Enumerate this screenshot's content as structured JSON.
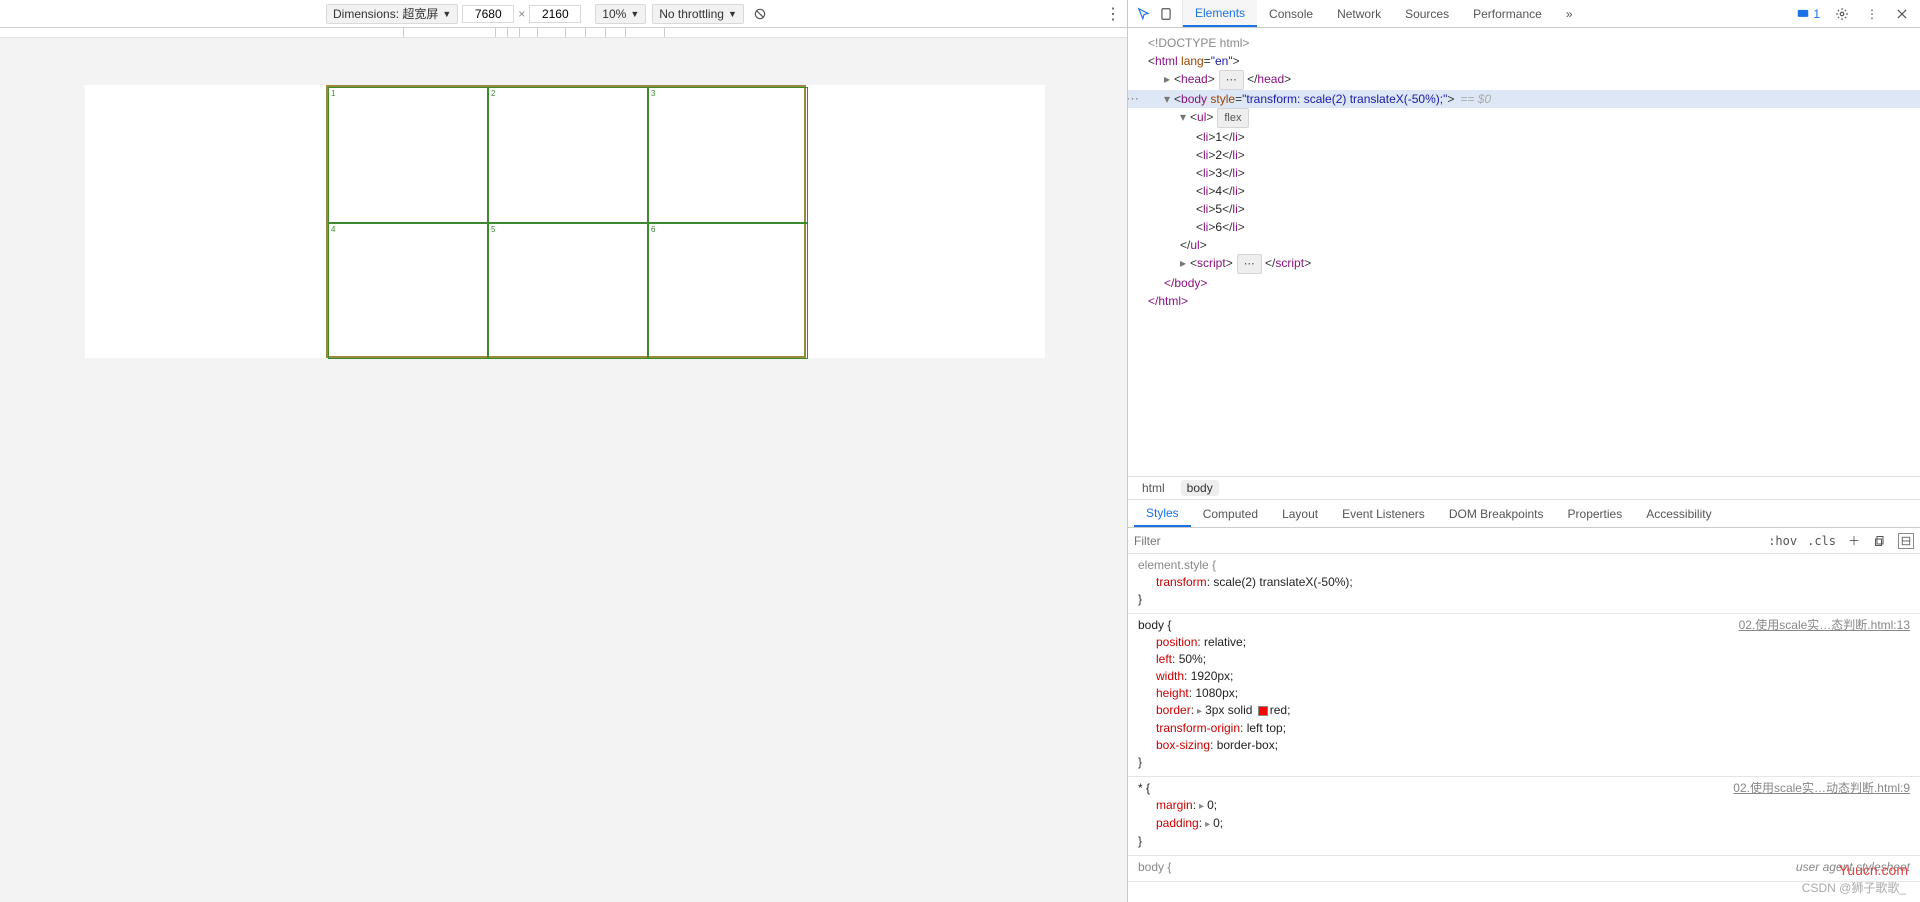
{
  "toolbar": {
    "dimensions_label": "Dimensions: 超宽屏",
    "width": "7680",
    "height": "2160",
    "zoom": "10%",
    "throttle": "No throttling"
  },
  "preview": {
    "cells": [
      "1",
      "2",
      "3",
      "4",
      "5",
      "6"
    ]
  },
  "devtools": {
    "tabs": [
      "Elements",
      "Console",
      "Network",
      "Sources",
      "Performance"
    ],
    "msg_count": "1",
    "tree": {
      "doctype": "<!DOCTYPE html>",
      "html_open": "html",
      "html_lang_attr": "lang",
      "html_lang_val": "\"en\"",
      "head": "head",
      "body": "body",
      "body_style_attr": "style",
      "body_style_val": "\"transform: scale(2) translateX(-50%);\"",
      "eq0": "== $0",
      "ul": "ul",
      "ul_pill": "flex",
      "li": "li",
      "li_vals": [
        "1",
        "2",
        "3",
        "4",
        "5",
        "6"
      ],
      "script": "script",
      "close_body": "</body>",
      "close_html": "</html>"
    },
    "crumbs": [
      "html",
      "body"
    ],
    "subtabs": [
      "Styles",
      "Computed",
      "Layout",
      "Event Listeners",
      "DOM Breakpoints",
      "Properties",
      "Accessibility"
    ],
    "filter_ph": "Filter",
    "hov": ":hov",
    "cls": ".cls",
    "rules": {
      "r1": {
        "sel": "element.style {",
        "p1": "transform",
        "v1": "scale(2) translateX(-50%);"
      },
      "r2": {
        "sel": "body {",
        "src": "02.使用scale实…态判断.html:13",
        "p1": "position",
        "v1": "relative;",
        "p2": "left",
        "v2": "50%;",
        "p3": "width",
        "v3": "1920px;",
        "p4": "height",
        "v4": "1080px;",
        "p5": "border",
        "v5a": "3px solid ",
        "v5b": "red;",
        "p6": "transform-origin",
        "v6": "left top;",
        "p7": "box-sizing",
        "v7": "border-box;"
      },
      "r3": {
        "sel": "* {",
        "src": "02.使用scale实…动态判断.html:9",
        "p1": "margin",
        "v1": "0;",
        "p2": "padding",
        "v2": "0;"
      },
      "r4": {
        "sel": "body {",
        "src": "user agent stylesheet"
      }
    }
  },
  "watermark1": "Yuucn.com",
  "watermark2": "CSDN @狮子歌歌_"
}
